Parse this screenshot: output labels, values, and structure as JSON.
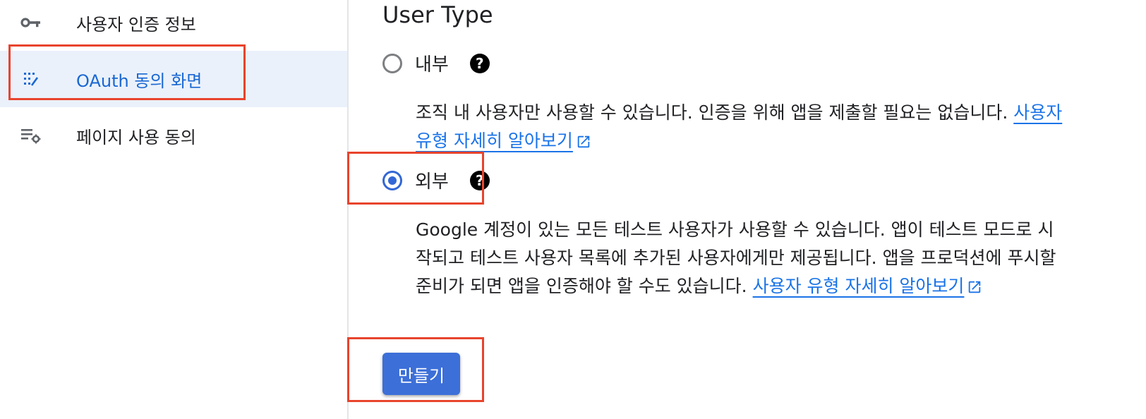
{
  "sidebar": {
    "items": [
      {
        "label": "사용자 인증 정보",
        "icon": "key-icon",
        "active": false
      },
      {
        "label": "OAuth 동의 화면",
        "icon": "consent-screen-icon",
        "active": true
      },
      {
        "label": "페이지 사용 동의",
        "icon": "list-settings-icon",
        "active": false
      }
    ]
  },
  "main": {
    "section_title": "User Type",
    "options": [
      {
        "label": "내부",
        "selected": false,
        "description": "조직 내 사용자만 사용할 수 있습니다. 인증을 위해 앱을 제출할 필요는 없습니다. ",
        "link_text": "사용자 유형 자세히 알아보기"
      },
      {
        "label": "외부",
        "selected": true,
        "description": "Google 계정이 있는 모든 테스트 사용자가 사용할 수 있습니다. 앱이 테스트 모드로 시작되고 테스트 사용자 목록에 추가된 사용자에게만 제공됩니다. 앱을 프로덕션에 푸시할 준비가 되면 앱을 인증해야 할 수도 있습니다. ",
        "link_text": "사용자 유형 자세히 알아보기"
      }
    ],
    "help_glyph": "?",
    "create_button": "만들기"
  },
  "colors": {
    "accent": "#1a73e8",
    "active_nav_bg": "#eaf1fb",
    "highlight": "#e8442d",
    "button": "#3c6fd8"
  }
}
